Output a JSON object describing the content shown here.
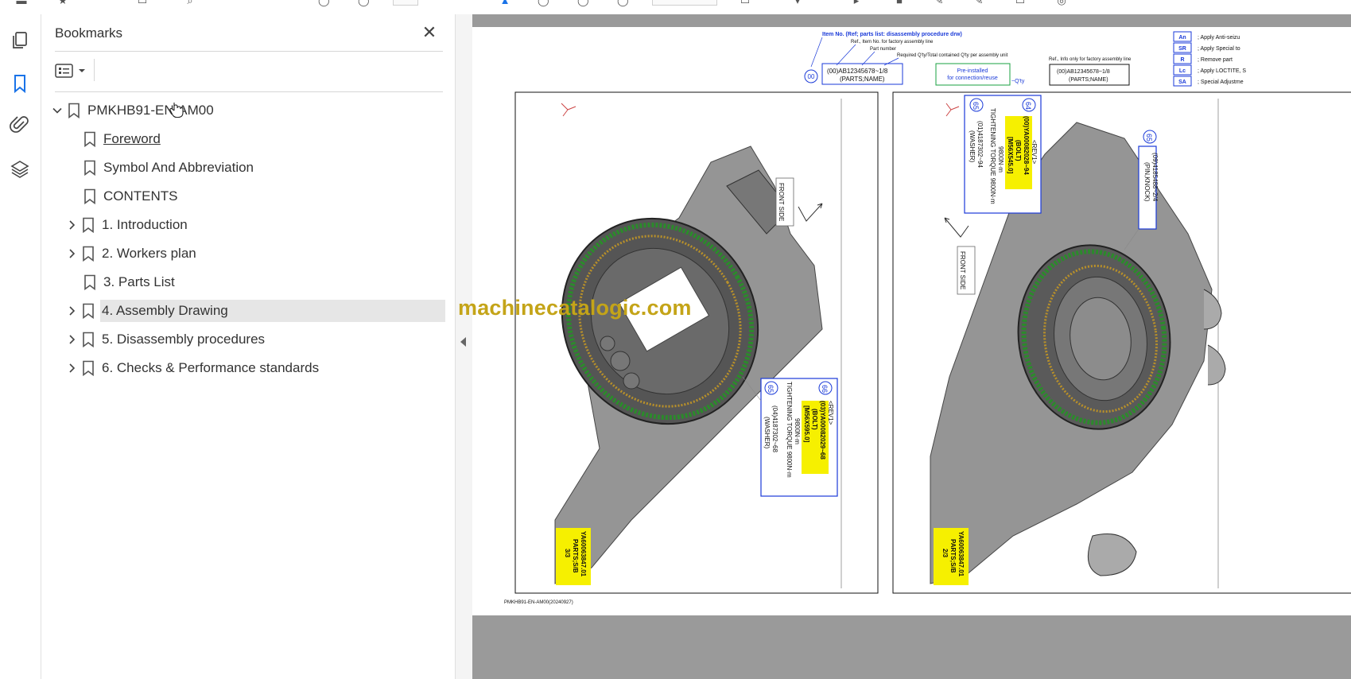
{
  "panel": {
    "title": "Bookmarks",
    "close_label": "✕"
  },
  "bookmarks": [
    {
      "label": "PMKHB91-EN-AM00",
      "expanded": true,
      "has_children": true,
      "level": 0
    },
    {
      "label": "Foreword",
      "has_children": false,
      "level": 1,
      "hover": true
    },
    {
      "label": "Symbol And Abbreviation",
      "has_children": false,
      "level": 1
    },
    {
      "label": "CONTENTS",
      "has_children": false,
      "level": 1
    },
    {
      "label": "1. Introduction",
      "has_children": true,
      "level": 1
    },
    {
      "label": "2. Workers plan",
      "has_children": true,
      "level": 1
    },
    {
      "label": "3. Parts List",
      "has_children": false,
      "level": 1
    },
    {
      "label": "4. Assembly Drawing",
      "has_children": true,
      "level": 1,
      "selected": true
    },
    {
      "label": "5. Disassembly procedures",
      "has_children": true,
      "level": 1
    },
    {
      "label": "6. Checks & Performance standards",
      "has_children": true,
      "level": 1
    }
  ],
  "rail": {
    "icons": [
      "pages-icon",
      "bookmark-icon",
      "attachment-icon",
      "layers-icon"
    ]
  },
  "watermark": "machinecatalogic.com",
  "drawing": {
    "legend_top": {
      "item_no": "Item No. (Ref; parts list: disassembly procedure drw)",
      "ref_item": "Ref., Item No. for factory assembly line",
      "part_number": "Part number",
      "required_qty": "Required Q'ty/Total contained Q'ty per assembly unit",
      "circle_no": "00",
      "box_line1": "(00)AB12345678~1/8",
      "box_line2": "(PARTS;NAME)",
      "preinstalled_line1": "Pre-installed",
      "preinstalled_line2": "for connection/reuse",
      "qty_suffix": "~Q'ty",
      "ref_info": "Ref., Info only for factory assembly line",
      "box2_line1": "(00)AB12345678~1/8",
      "box2_line2": "(PARTS;NAME)"
    },
    "legend_right": [
      {
        "code": "An",
        "text": "; Apply Anti-seizu"
      },
      {
        "code": "SR",
        "text": "; Apply Special to"
      },
      {
        "code": "R",
        "text": "; Remove part"
      },
      {
        "code": "Lc",
        "text": "; Apply LOCTITE, S"
      },
      {
        "code": "SA",
        "text": "; Special Adjustme"
      }
    ],
    "left_view": {
      "front_side": "FRONT SIDE",
      "callout_66": "66",
      "callout_65": "65",
      "rev": "<REV1>",
      "part_line1": "(03)YA00082029~68",
      "part_line2": "(BOLT)",
      "part_line3": "[M56X595.0]",
      "torque_line1": "9800N·m",
      "torque_line2": "TIGHTENING TORQUE 9800N·m",
      "washer_line1": "(04)4187302~68",
      "washer_line2": "(WASHER)",
      "title_block1": "YA60063847.01",
      "title_block2": "PARTS;S/B",
      "title_block3": "3/3"
    },
    "right_view": {
      "front_side": "FRONT SIDE",
      "callout_64": "64",
      "callout_65": "65",
      "callout_65b": "65",
      "rev": "<REV1>",
      "part_line1": "(00)YA00082028~94",
      "part_line2": "(BOLT)",
      "part_line3": "[M56X545.0]",
      "torque_line1": "9800N·m",
      "torque_line2": "TIGHTENING TORQUE 9800N·m",
      "washer_line1": "(01)4187302~94",
      "washer_line2": "(WASHER)",
      "pin_line1": "(09)4185488~2/4",
      "pin_line2": "(PIN,KNOCK)",
      "title_block1": "YA60063847.01",
      "title_block2": "PARTS;S/B",
      "title_block3": "2/3"
    },
    "footer_code": "PMKHB91-EN-AM00(20240927)"
  }
}
